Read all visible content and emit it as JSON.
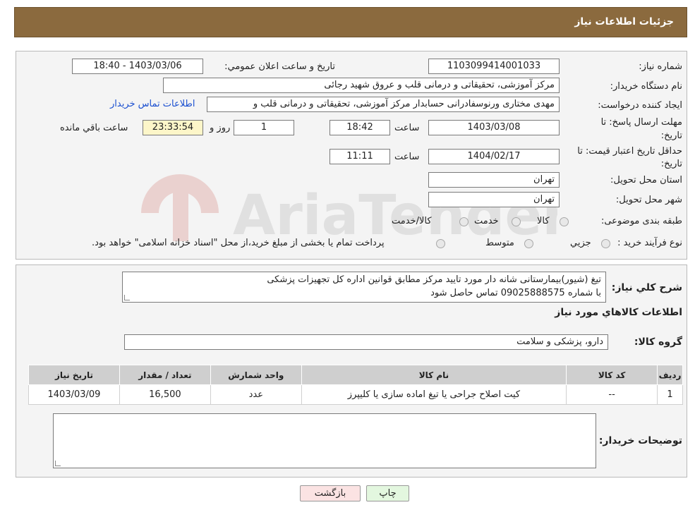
{
  "header": {
    "title": "جزئیات اطلاعات نیاز"
  },
  "form": {
    "need_number_label": "شماره نیاز:",
    "need_number": "1103099414001033",
    "announce_label": "تاریخ و ساعت اعلان عمومي:",
    "announce_value": "1403/03/06 - 18:40",
    "buyer_org_label": "نام دستگاه خریدار:",
    "buyer_org": "مرکز آموزشی، تحقیقاتی و درمانی قلب و عروق شهید رجائی",
    "creator_label": "ایجاد کننده درخواست:",
    "creator": "مهدی مختاری ورنوسفادرانی حسابدار مرکز آموزشی، تحقیقاتی و درمانی قلب و",
    "contact_link": "اطلاعات تماس خریدار",
    "deadline_label_1": "مهلت ارسال پاسخ: تا",
    "deadline_label_2": "تاریخ:",
    "deadline_date": "1403/03/08",
    "time_label": "ساعت",
    "deadline_time": "18:42",
    "days": "1",
    "days_label": "روز و",
    "remaining": "23:33:54",
    "remaining_label": "ساعت باقي مانده",
    "validity_label_1": "حداقل تاریخ اعتبار قیمت: تا",
    "validity_label_2": "تاریخ:",
    "validity_date": "1404/02/17",
    "validity_time": "11:11",
    "province_label": "استان محل تحویل:",
    "province": "تهران",
    "city_label": "شهر محل تحویل:",
    "city": "تهران",
    "category_label": "طبقه بندی موضوعی:",
    "category_options": [
      "کالا",
      "خدمت",
      "کالا/خدمت"
    ],
    "process_label": "نوع فرآیند خرید :",
    "process_options": [
      "جزیي",
      "متوسط"
    ],
    "process_note": "پرداخت تمام یا بخشی از مبلغ خرید،از محل \"اسناد خزانه اسلامی\" خواهد بود."
  },
  "details": {
    "summary_label": "شرح کلي نياز:",
    "summary_line1": "تیغ (شیور)بیمارستانی شانه دار مورد تایید مرکز مطابق قوانین اداره کل تجهیزات پزشکی",
    "summary_line2": "با شماره 09025888575 تماس حاصل شود",
    "goods_title": "اطلاعات کالاهاي مورد نياز",
    "group_label": "گروه کالا:",
    "group_value": "دارو، پزشکی و سلامت",
    "table": {
      "headers": [
        "ردیف",
        "کد کالا",
        "نام کالا",
        "واحد شمارش",
        "تعداد / مقدار",
        "تاریخ نیاز"
      ],
      "rows": [
        [
          "1",
          "--",
          "کیت اصلاح جراحی یا تیغ اماده سازی یا کلیپرز",
          "عدد",
          "16,500",
          "1403/03/09"
        ]
      ]
    },
    "buyer_notes_label": "توضیحات خریدار:"
  },
  "buttons": {
    "print": "چاپ",
    "back": "بازگشت"
  },
  "watermark_text": "AriaTender.neT",
  "colors": {
    "header": "#8b6a3e",
    "link": "#1a4fd0",
    "back_button": "#fbe3e3",
    "print_button": "#e3f7df"
  }
}
